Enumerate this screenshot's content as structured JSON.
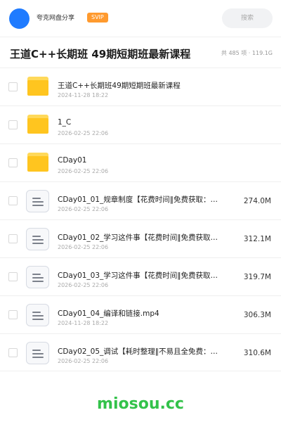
{
  "header": {
    "app_name": "夸克网盘分享",
    "badge": "SVIP",
    "search_placeholder": "搜索"
  },
  "folder": {
    "title": "王道C++长期班 49期短期班最新课程",
    "meta": "共 485 项 · 119.1G"
  },
  "files": [
    {
      "name": "王道C++长期班49期短期班最新课程",
      "date": "2024-11-28 18:22",
      "size": "",
      "type": "folder"
    },
    {
      "name": "1_C",
      "date": "2026-02-25 22:06",
      "size": "",
      "type": "folder"
    },
    {
      "name": "CDay01",
      "date": "2026-02-25 22:06",
      "size": "",
      "type": "folder"
    },
    {
      "name": "CDay01_01_规章制度【花费时间‖免费获取：…",
      "date": "2026-02-25 22:06",
      "size": "274.0M",
      "type": "file"
    },
    {
      "name": "CDay01_02_学习这件事【花费时间‖免费获取…",
      "date": "2026-02-25 22:06",
      "size": "312.1M",
      "type": "file"
    },
    {
      "name": "CDay01_03_学习这件事【花费时间‖免费获取…",
      "date": "2026-02-25 22:06",
      "size": "319.7M",
      "type": "file"
    },
    {
      "name": "CDay01_04_编译和链接.mp4",
      "date": "2024-11-28 18:22",
      "size": "306.3M",
      "type": "file"
    },
    {
      "name": "CDay02_05_调试【耗时整理‖不易且全免费：…",
      "date": "2026-02-25 22:06",
      "size": "310.6M",
      "type": "file"
    }
  ],
  "watermark": "miosou.cc",
  "colors": {
    "avatar": "#1f7bff",
    "badge": "#ff9a2e",
    "folder": "#ffc51f",
    "watermark": "#33c24a"
  }
}
